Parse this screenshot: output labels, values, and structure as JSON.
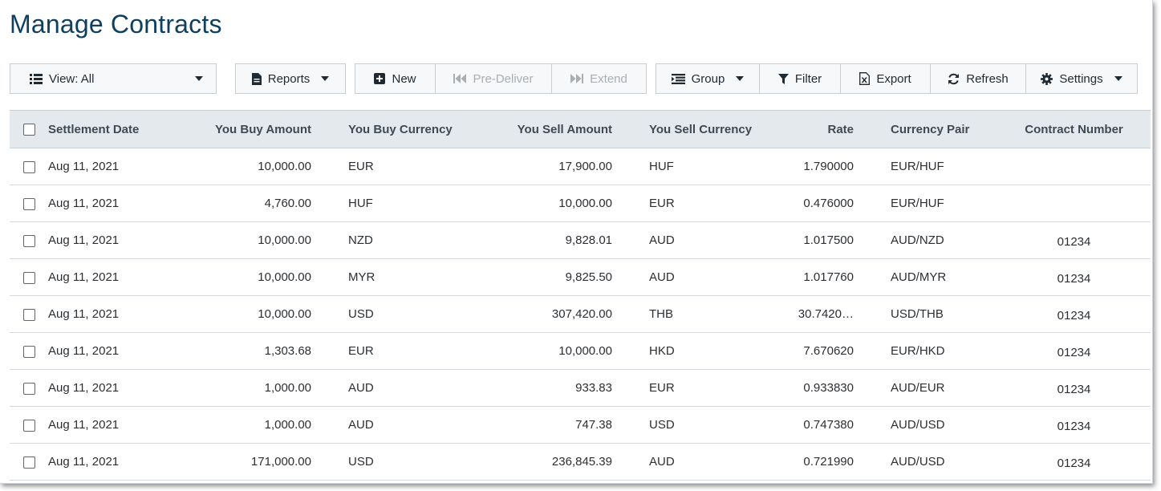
{
  "page": {
    "title": "Manage Contracts"
  },
  "toolbar": {
    "view_label": "View: All",
    "reports_label": "Reports",
    "new_label": "New",
    "predeliver_label": "Pre-Deliver",
    "extend_label": "Extend",
    "group_label": "Group",
    "filter_label": "Filter",
    "export_label": "Export",
    "refresh_label": "Refresh",
    "settings_label": "Settings"
  },
  "table": {
    "headers": {
      "settlement_date": "Settlement Date",
      "buy_amount": "You Buy Amount",
      "buy_currency": "You Buy Currency",
      "sell_amount": "You Sell Amount",
      "sell_currency": "You Sell Currency",
      "rate": "Rate",
      "pair": "Currency Pair",
      "contract": "Contract Number"
    },
    "rows": [
      {
        "date": "Aug 11, 2021",
        "buy_amount": "10,000.00",
        "buy_currency": "EUR",
        "sell_amount": "17,900.00",
        "sell_currency": "HUF",
        "rate": "1.790000",
        "pair": "EUR/HUF",
        "contract": ""
      },
      {
        "date": "Aug 11, 2021",
        "buy_amount": "4,760.00",
        "buy_currency": "HUF",
        "sell_amount": "10,000.00",
        "sell_currency": "EUR",
        "rate": "0.476000",
        "pair": "EUR/HUF",
        "contract": ""
      },
      {
        "date": "Aug 11, 2021",
        "buy_amount": "10,000.00",
        "buy_currency": "NZD",
        "sell_amount": "9,828.01",
        "sell_currency": "AUD",
        "rate": "1.017500",
        "pair": "AUD/NZD",
        "contract": "01234"
      },
      {
        "date": "Aug 11, 2021",
        "buy_amount": "10,000.00",
        "buy_currency": "MYR",
        "sell_amount": "9,825.50",
        "sell_currency": "AUD",
        "rate": "1.017760",
        "pair": "AUD/MYR",
        "contract": "01234"
      },
      {
        "date": "Aug 11, 2021",
        "buy_amount": "10,000.00",
        "buy_currency": "USD",
        "sell_amount": "307,420.00",
        "sell_currency": "THB",
        "rate": "30.7420…",
        "pair": "USD/THB",
        "contract": "01234"
      },
      {
        "date": "Aug 11, 2021",
        "buy_amount": "1,303.68",
        "buy_currency": "EUR",
        "sell_amount": "10,000.00",
        "sell_currency": "HKD",
        "rate": "7.670620",
        "pair": "EUR/HKD",
        "contract": "01234"
      },
      {
        "date": "Aug 11, 2021",
        "buy_amount": "1,000.00",
        "buy_currency": "AUD",
        "sell_amount": "933.83",
        "sell_currency": "EUR",
        "rate": "0.933830",
        "pair": "AUD/EUR",
        "contract": "01234"
      },
      {
        "date": "Aug 11, 2021",
        "buy_amount": "1,000.00",
        "buy_currency": "AUD",
        "sell_amount": "747.38",
        "sell_currency": "USD",
        "rate": "0.747380",
        "pair": "AUD/USD",
        "contract": "01234"
      },
      {
        "date": "Aug 11, 2021",
        "buy_amount": "171,000.00",
        "buy_currency": "USD",
        "sell_amount": "236,845.39",
        "sell_currency": "AUD",
        "rate": "0.721990",
        "pair": "AUD/USD",
        "contract": "01234"
      }
    ]
  },
  "colors": {
    "title": "#0f3f5f",
    "header_bg": "#e4e9ed",
    "button_bg": "#f7f8f9",
    "disabled_text": "#a9aeb3"
  },
  "icons": {
    "view": "list-icon",
    "reports": "document-icon",
    "new": "plus-square-icon",
    "predeliver": "skip-back-icon",
    "extend": "skip-forward-icon",
    "group": "group-list-icon",
    "filter": "funnel-icon",
    "export": "excel-file-icon",
    "refresh": "refresh-icon",
    "settings": "gear-icon"
  }
}
